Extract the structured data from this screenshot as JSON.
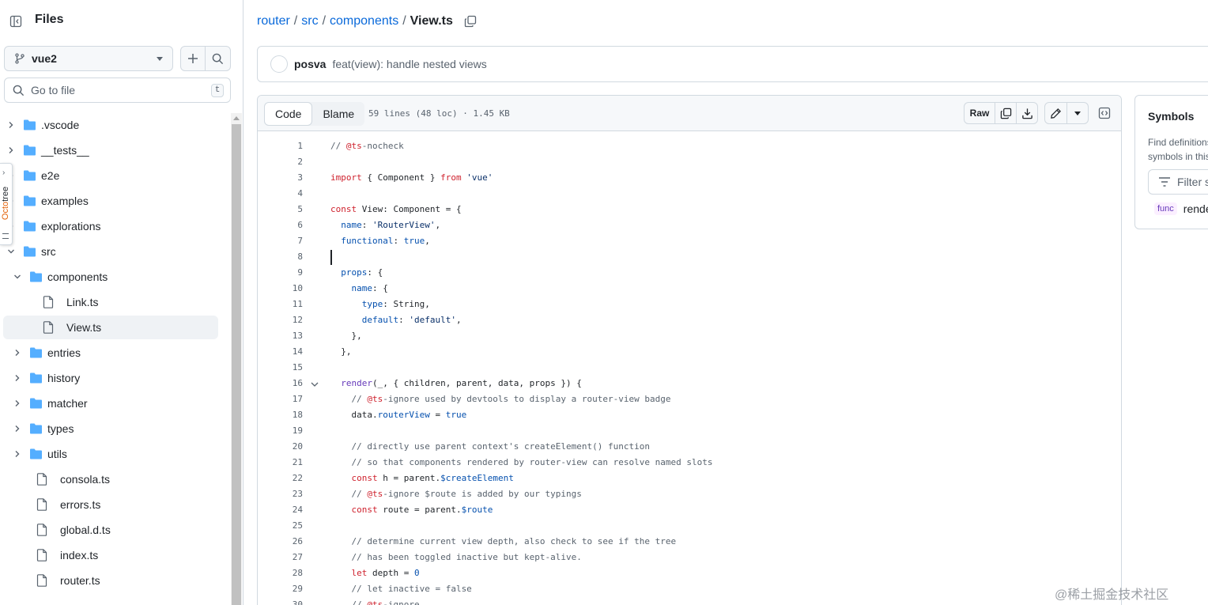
{
  "sidebar": {
    "title": "Files",
    "branch": "vue2",
    "goto_placeholder": "Go to file",
    "goto_shortcut": "t",
    "tree": [
      {
        "name": ".vscode",
        "type": "folder",
        "depth": 0,
        "expanded": false
      },
      {
        "name": "__tests__",
        "type": "folder",
        "depth": 0,
        "expanded": false
      },
      {
        "name": "e2e",
        "type": "folder",
        "depth": 0,
        "expanded": false
      },
      {
        "name": "examples",
        "type": "folder",
        "depth": 0,
        "expanded": false
      },
      {
        "name": "explorations",
        "type": "folder",
        "depth": 0,
        "expanded": false
      },
      {
        "name": "src",
        "type": "folder",
        "depth": 0,
        "expanded": true
      },
      {
        "name": "components",
        "type": "folder",
        "depth": 1,
        "expanded": true
      },
      {
        "name": "Link.ts",
        "type": "file",
        "depth": 2
      },
      {
        "name": "View.ts",
        "type": "file",
        "depth": 2,
        "selected": true
      },
      {
        "name": "entries",
        "type": "folder",
        "depth": 1,
        "expanded": false
      },
      {
        "name": "history",
        "type": "folder",
        "depth": 1,
        "expanded": false
      },
      {
        "name": "matcher",
        "type": "folder",
        "depth": 1,
        "expanded": false
      },
      {
        "name": "types",
        "type": "folder",
        "depth": 1,
        "expanded": false
      },
      {
        "name": "utils",
        "type": "folder",
        "depth": 1,
        "expanded": false
      },
      {
        "name": "consola.ts",
        "type": "file",
        "depth": 1
      },
      {
        "name": "errors.ts",
        "type": "file",
        "depth": 1
      },
      {
        "name": "global.d.ts",
        "type": "file",
        "depth": 1
      },
      {
        "name": "index.ts",
        "type": "file",
        "depth": 1
      },
      {
        "name": "router.ts",
        "type": "file",
        "depth": 1
      }
    ]
  },
  "octotree": {
    "brand": "Octo",
    "rest": "tree"
  },
  "breadcrumb": {
    "parts": [
      "router",
      "src",
      "components"
    ],
    "current": "View.ts"
  },
  "commit": {
    "author": "posva",
    "message": "feat(view): handle nested views"
  },
  "code_header": {
    "tabs": [
      "Code",
      "Blame"
    ],
    "active_tab": "Code",
    "file_info": "59 lines (48 loc) · 1.45 KB",
    "raw_label": "Raw"
  },
  "code": [
    {
      "n": "1",
      "t": [
        [
          "c",
          "// "
        ],
        [
          "k",
          "@ts"
        ],
        [
          "c",
          "-nocheck"
        ]
      ]
    },
    {
      "n": "2",
      "t": []
    },
    {
      "n": "3",
      "t": [
        [
          "k",
          "import"
        ],
        [
          "",
          " { Component } "
        ],
        [
          "k",
          "from"
        ],
        [
          "s",
          " 'vue'"
        ]
      ]
    },
    {
      "n": "4",
      "t": []
    },
    {
      "n": "5",
      "t": [
        [
          "k",
          "const"
        ],
        [
          "",
          " View: Component = {"
        ]
      ]
    },
    {
      "n": "6",
      "t": [
        [
          "",
          "  "
        ],
        [
          "p",
          "name"
        ],
        [
          "",
          ": "
        ],
        [
          "s",
          "'RouterView'"
        ],
        [
          "",
          ","
        ]
      ]
    },
    {
      "n": "7",
      "t": [
        [
          "",
          "  "
        ],
        [
          "p",
          "functional"
        ],
        [
          "",
          ": "
        ],
        [
          "p",
          "true"
        ],
        [
          "",
          ","
        ]
      ]
    },
    {
      "n": "8",
      "t": [],
      "caret": true
    },
    {
      "n": "9",
      "t": [
        [
          "",
          "  "
        ],
        [
          "p",
          "props"
        ],
        [
          "",
          ": {"
        ]
      ]
    },
    {
      "n": "10",
      "t": [
        [
          "",
          "    "
        ],
        [
          "p",
          "name"
        ],
        [
          "",
          ": {"
        ]
      ]
    },
    {
      "n": "11",
      "t": [
        [
          "",
          "      "
        ],
        [
          "p",
          "type"
        ],
        [
          "",
          ": String,"
        ]
      ]
    },
    {
      "n": "12",
      "t": [
        [
          "",
          "      "
        ],
        [
          "p",
          "default"
        ],
        [
          "",
          ": "
        ],
        [
          "s",
          "'default'"
        ],
        [
          "",
          ","
        ]
      ]
    },
    {
      "n": "13",
      "t": [
        [
          "",
          "    },"
        ]
      ]
    },
    {
      "n": "14",
      "t": [
        [
          "",
          "  },"
        ]
      ]
    },
    {
      "n": "15",
      "t": []
    },
    {
      "n": "16",
      "t": [
        [
          "",
          "  "
        ],
        [
          "f",
          "render"
        ],
        [
          "",
          "(_, { children, parent, data, props }) {"
        ]
      ],
      "fold": true
    },
    {
      "n": "17",
      "t": [
        [
          "c",
          "    // "
        ],
        [
          "k",
          "@ts"
        ],
        [
          "c",
          "-ignore used by devtools to display a router-view badge"
        ]
      ]
    },
    {
      "n": "18",
      "t": [
        [
          "",
          "    data."
        ],
        [
          "p",
          "routerView"
        ],
        [
          "",
          " = "
        ],
        [
          "p",
          "true"
        ]
      ]
    },
    {
      "n": "19",
      "t": []
    },
    {
      "n": "20",
      "t": [
        [
          "c",
          "    // directly use parent context's createElement() function"
        ]
      ]
    },
    {
      "n": "21",
      "t": [
        [
          "c",
          "    // so that components rendered by router-view can resolve named slots"
        ]
      ]
    },
    {
      "n": "22",
      "t": [
        [
          "",
          "    "
        ],
        [
          "k",
          "const"
        ],
        [
          "",
          " h = parent."
        ],
        [
          "p",
          "$createElement"
        ]
      ]
    },
    {
      "n": "23",
      "t": [
        [
          "c",
          "    // "
        ],
        [
          "k",
          "@ts"
        ],
        [
          "c",
          "-ignore $route is added by our typings"
        ]
      ]
    },
    {
      "n": "24",
      "t": [
        [
          "",
          "    "
        ],
        [
          "k",
          "const"
        ],
        [
          "",
          " route = parent."
        ],
        [
          "p",
          "$route"
        ]
      ]
    },
    {
      "n": "25",
      "t": []
    },
    {
      "n": "26",
      "t": [
        [
          "c",
          "    // determine current view depth, also check to see if the tree"
        ]
      ]
    },
    {
      "n": "27",
      "t": [
        [
          "c",
          "    // has been toggled inactive but kept-alive."
        ]
      ]
    },
    {
      "n": "28",
      "t": [
        [
          "",
          "    "
        ],
        [
          "k",
          "let"
        ],
        [
          "",
          " depth = "
        ],
        [
          "p",
          "0"
        ]
      ]
    },
    {
      "n": "29",
      "t": [
        [
          "c",
          "    // let inactive = false"
        ]
      ]
    },
    {
      "n": "30",
      "t": [
        [
          "c",
          "    // "
        ],
        [
          "k",
          "@ts"
        ],
        [
          "c",
          "-ignore"
        ]
      ]
    }
  ],
  "symbols": {
    "title": "Symbols",
    "desc_line1": "Find definitions and references for functions and other",
    "desc_line2": "symbols in this file",
    "filter_placeholder": "Filter symbols",
    "items": [
      {
        "kind": "func",
        "name": "render"
      }
    ]
  },
  "watermark": "@稀土掘金技术社区",
  "colors": {
    "accent": "#0969da",
    "folder": "#54aeff",
    "border": "#d1d9e0"
  }
}
